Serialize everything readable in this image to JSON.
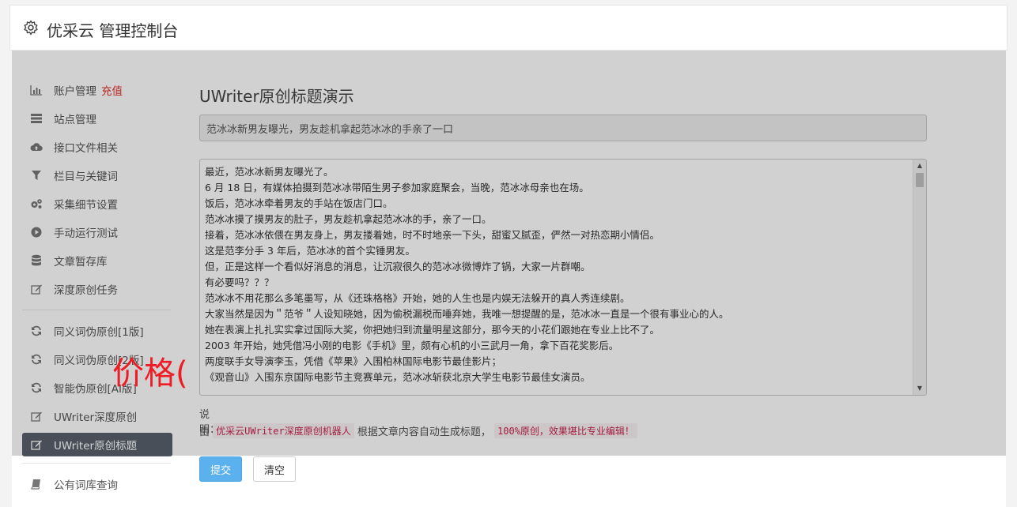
{
  "header": {
    "title": "优采云 管理控制台"
  },
  "sidebar": {
    "group1": [
      {
        "label": "账户管理",
        "tag": "充值",
        "icon": "bar-chart-icon"
      },
      {
        "label": "站点管理",
        "icon": "server-icon"
      },
      {
        "label": "接口文件相关",
        "icon": "cloud-upload-icon"
      },
      {
        "label": "栏目与关键词",
        "icon": "filter-icon"
      },
      {
        "label": "采集细节设置",
        "icon": "cogs-icon"
      },
      {
        "label": "手动运行测试",
        "icon": "play-circle-icon"
      },
      {
        "label": "文章暂存库",
        "icon": "database-icon"
      },
      {
        "label": "深度原创任务",
        "icon": "edit-icon"
      }
    ],
    "group2": [
      {
        "label": "同义词伪原创[1版]",
        "icon": "refresh-icon"
      },
      {
        "label": "同义词伪原创[2版]",
        "icon": "refresh-icon"
      },
      {
        "label": "智能伪原创[AI版]",
        "icon": "refresh-icon"
      },
      {
        "label": "UWriter深度原创",
        "icon": "edit-icon"
      },
      {
        "label": "UWriter原创标题",
        "icon": "edit-icon",
        "active": true
      }
    ],
    "group3": [
      {
        "label": "公有词库查询",
        "icon": "book-icon"
      }
    ]
  },
  "main": {
    "page_title": "UWriter原创标题演示",
    "title_value": "范冰冰新男友曝光，男友趁机拿起范冰冰的手亲了一口",
    "content_lines": [
      "最近，范冰冰新男友曝光了。",
      "6 月 18 日，有媒体拍摄到范冰冰带陌生男子参加家庭聚会，当晚，范冰冰母亲也在场。",
      "饭后，范冰冰牵着男友的手站在饭店门口。",
      "范冰冰摸了摸男友的肚子，男友趁机拿起范冰冰的手，亲了一口。",
      "接着，范冰冰依偎在男友身上，男友搂着她，时不时地亲一下头，甜蜜又腻歪，俨然一对热恋期小情侣。",
      "这是范李分手 3 年后，范冰冰的首个实锤男友。",
      "但，正是这样一个看似好消息的消息，让沉寂很久的范冰冰微博炸了锅，大家一片群嘲。",
      "有必要吗？？？",
      "范冰冰不用花那么多笔墨写，从《还珠格格》开始，她的人生也是内娱无法躲开的真人秀连续剧。",
      "大家当然是因为＂范爷＂人设知晓她，因为偷税漏税而唾弃她，我唯一想提醒的是，范冰冰一直是一个很有事业心的人。",
      "她在表演上扎扎实实拿过国际大奖，你把她归到流量明星这部分，那今天的小花们跟她在专业上比不了。",
      "2003 年开始，她凭借冯小刚的电影《手机》里，颇有心机的小三武月一角，拿下百花奖影后。",
      "两度联手女导演李玉，凭借《苹果》入围柏林国际电影节最佳影片；",
      "《观音山》入围东京国际电影节主竞赛单元，范冰冰斩获北京大学生电影节最佳女演员。"
    ],
    "desc_label": "说明：",
    "desc_prefix": "由",
    "desc_code1": "优采云UWriter深度原创机器人",
    "desc_middle": "根据文章内容自动生成标题，",
    "desc_code2": "100%原创，效果堪比专业编辑！",
    "submit_label": "提交",
    "clear_label": "清空"
  },
  "overlay_text": "价格(",
  "colors": {
    "accent": "#5bb0ee",
    "active_nav": "#5a616c",
    "tag_red": "#e0312d",
    "code_red": "#c7254e",
    "overlay_red": "#ee1c24"
  }
}
